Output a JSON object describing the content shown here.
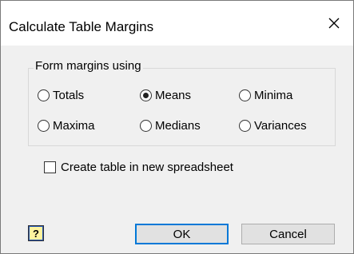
{
  "window": {
    "title": "Calculate Table Margins",
    "close_icon": "close-icon"
  },
  "group": {
    "label": "Form margins using",
    "options": [
      {
        "label": "Totals",
        "selected": false
      },
      {
        "label": "Means",
        "selected": true
      },
      {
        "label": "Minima",
        "selected": false
      },
      {
        "label": "Maxima",
        "selected": false
      },
      {
        "label": "Medians",
        "selected": false
      },
      {
        "label": "Variances",
        "selected": false
      }
    ]
  },
  "checkbox": {
    "label": "Create table in new spreadsheet",
    "checked": false
  },
  "buttons": {
    "help_label": "?",
    "ok_label": "OK",
    "cancel_label": "Cancel"
  },
  "colors": {
    "default_button_border": "#0078d7",
    "help_button_bg": "#fff3a0"
  }
}
